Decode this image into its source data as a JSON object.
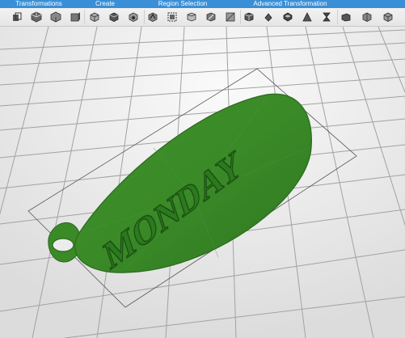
{
  "toolbar": {
    "accent_color": "#3a8fd6",
    "categories": [
      {
        "label": "Transformations"
      },
      {
        "label": "Create"
      },
      {
        "label": "Region Selection"
      },
      {
        "label": "Advanced Transformation"
      }
    ],
    "tools": [
      {
        "icon": "move-icon"
      },
      {
        "icon": "rotate-icon"
      },
      {
        "icon": "scale-icon"
      },
      {
        "icon": "mirror-icon"
      },
      {
        "icon": "box-primitive-icon"
      },
      {
        "icon": "cylinder-primitive-icon"
      },
      {
        "icon": "sphere-primitive-icon"
      },
      {
        "icon": "cone-primitive-icon"
      },
      {
        "icon": "select-all-icon"
      },
      {
        "icon": "select-faces-icon"
      },
      {
        "icon": "brush-select-icon"
      },
      {
        "icon": "lasso-select-icon"
      },
      {
        "icon": "invert-selection-icon"
      },
      {
        "icon": "extrude-icon"
      },
      {
        "icon": "hollow-icon"
      },
      {
        "icon": "smooth-icon"
      },
      {
        "icon": "twist-icon"
      },
      {
        "icon": "bend-icon"
      },
      {
        "icon": "taper-icon"
      },
      {
        "icon": "split-icon"
      }
    ]
  },
  "viewport": {
    "background": "#ededed",
    "grid_color": "#9a9a9a",
    "model_color": "#3a8a28",
    "model": {
      "text": "MONDAY"
    }
  }
}
